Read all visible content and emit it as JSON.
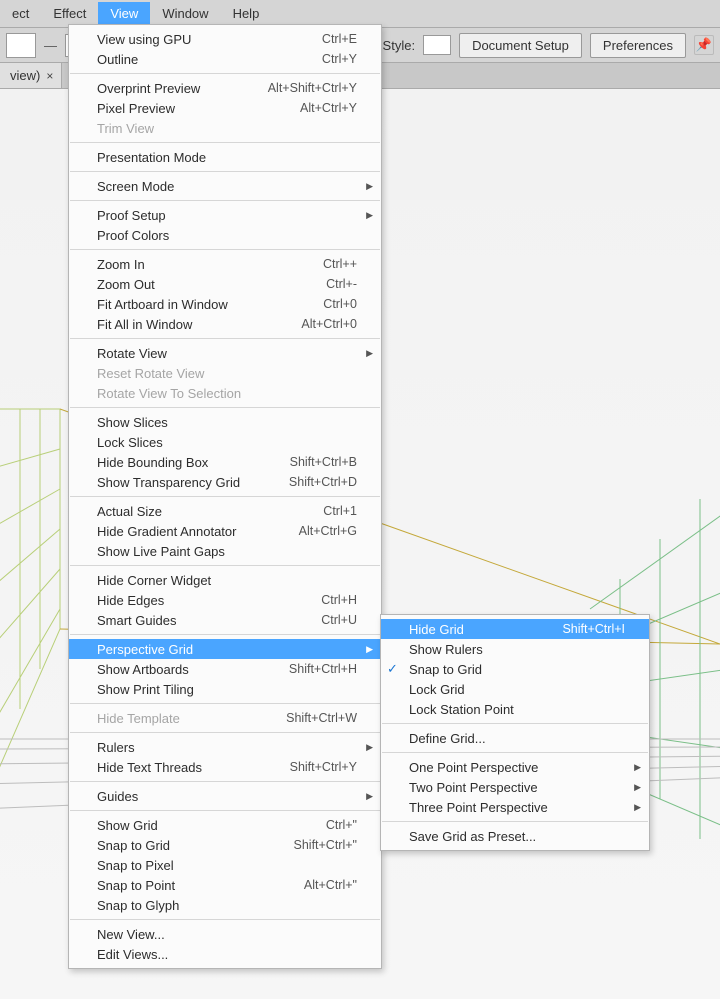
{
  "menubar": {
    "items": [
      "ect",
      "Effect",
      "View",
      "Window",
      "Help"
    ],
    "active_index": 2
  },
  "toolbar": {
    "style_label": "Style:",
    "doc_setup": "Document Setup",
    "preferences": "Preferences"
  },
  "doctab": {
    "label": "view)",
    "close": "×"
  },
  "view_menu": {
    "g0": [
      {
        "label": "View using GPU",
        "shortcut": "Ctrl+E"
      },
      {
        "label": "Outline",
        "shortcut": "Ctrl+Y"
      }
    ],
    "g1": [
      {
        "label": "Overprint Preview",
        "shortcut": "Alt+Shift+Ctrl+Y"
      },
      {
        "label": "Pixel Preview",
        "shortcut": "Alt+Ctrl+Y"
      },
      {
        "label": "Trim View",
        "disabled": true
      }
    ],
    "g2": [
      {
        "label": "Presentation Mode"
      }
    ],
    "g3": [
      {
        "label": "Screen Mode",
        "arrow": true
      }
    ],
    "g4": [
      {
        "label": "Proof Setup",
        "arrow": true
      },
      {
        "label": "Proof Colors"
      }
    ],
    "g5": [
      {
        "label": "Zoom In",
        "shortcut": "Ctrl++"
      },
      {
        "label": "Zoom Out",
        "shortcut": "Ctrl+-"
      },
      {
        "label": "Fit Artboard in Window",
        "shortcut": "Ctrl+0"
      },
      {
        "label": "Fit All in Window",
        "shortcut": "Alt+Ctrl+0"
      }
    ],
    "g6": [
      {
        "label": "Rotate View",
        "arrow": true
      },
      {
        "label": "Reset Rotate View",
        "disabled": true
      },
      {
        "label": "Rotate View To Selection",
        "disabled": true
      }
    ],
    "g7": [
      {
        "label": "Show Slices"
      },
      {
        "label": "Lock Slices"
      },
      {
        "label": "Hide Bounding Box",
        "shortcut": "Shift+Ctrl+B"
      },
      {
        "label": "Show Transparency Grid",
        "shortcut": "Shift+Ctrl+D"
      }
    ],
    "g8": [
      {
        "label": "Actual Size",
        "shortcut": "Ctrl+1"
      },
      {
        "label": "Hide Gradient Annotator",
        "shortcut": "Alt+Ctrl+G"
      },
      {
        "label": "Show Live Paint Gaps"
      }
    ],
    "g9": [
      {
        "label": "Hide Corner Widget"
      },
      {
        "label": "Hide Edges",
        "shortcut": "Ctrl+H"
      },
      {
        "label": "Smart Guides",
        "shortcut": "Ctrl+U"
      }
    ],
    "g10": [
      {
        "label": "Perspective Grid",
        "arrow": true,
        "highlight": true
      },
      {
        "label": "Show Artboards",
        "shortcut": "Shift+Ctrl+H"
      },
      {
        "label": "Show Print Tiling"
      }
    ],
    "g11": [
      {
        "label": "Hide Template",
        "shortcut": "Shift+Ctrl+W",
        "disabled": true
      }
    ],
    "g12": [
      {
        "label": "Rulers",
        "arrow": true
      },
      {
        "label": "Hide Text Threads",
        "shortcut": "Shift+Ctrl+Y"
      }
    ],
    "g13": [
      {
        "label": "Guides",
        "arrow": true
      }
    ],
    "g14": [
      {
        "label": "Show Grid",
        "shortcut": "Ctrl+\""
      },
      {
        "label": "Snap to Grid",
        "shortcut": "Shift+Ctrl+\""
      },
      {
        "label": "Snap to Pixel"
      },
      {
        "label": "Snap to Point",
        "shortcut": "Alt+Ctrl+\""
      },
      {
        "label": "Snap to Glyph"
      }
    ],
    "g15": [
      {
        "label": "New View..."
      },
      {
        "label": "Edit Views..."
      }
    ]
  },
  "perspective_submenu": {
    "g0": [
      {
        "label": "Hide Grid",
        "shortcut": "Shift+Ctrl+I",
        "highlight": true
      },
      {
        "label": "Show Rulers"
      },
      {
        "label": "Snap to Grid",
        "checked": true
      },
      {
        "label": "Lock Grid"
      },
      {
        "label": "Lock Station Point"
      }
    ],
    "g1": [
      {
        "label": "Define Grid..."
      }
    ],
    "g2": [
      {
        "label": "One Point Perspective",
        "arrow": true
      },
      {
        "label": "Two Point Perspective",
        "arrow": true
      },
      {
        "label": "Three Point Perspective",
        "arrow": true
      }
    ],
    "g3": [
      {
        "label": "Save Grid as Preset..."
      }
    ]
  }
}
